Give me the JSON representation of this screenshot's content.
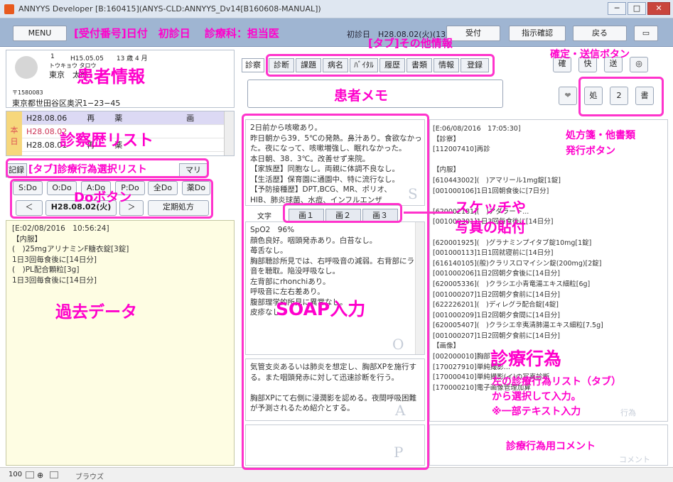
{
  "window": {
    "title": "ANNYYS Developer [B:160415](ANYS-CLD:ANNYYS_Dv14[B160608-MANUAL])",
    "min": "─",
    "max": "□",
    "close": "✕"
  },
  "toolbar": {
    "menu": "MENU",
    "header_text": "初診日　H28.08.02(火)(13歳)",
    "reception": "受付",
    "instruction_confirm": "指示確認",
    "back": "戻る"
  },
  "patient": {
    "id_number": "1",
    "birth": "H15.05.05　　13 歳 4 月",
    "kana": "トウキョウ タロウ",
    "name": "東京　太郎",
    "postal": "〒1580083",
    "address": "東京都世田谷区奥沢1−23−45"
  },
  "history": {
    "today_label": "本\n日",
    "rows": [
      {
        "date": "H28.08.06",
        "kind": "再",
        "cat": "薬",
        "extra": "画"
      },
      {
        "date": "H28.08.02",
        "kind": "",
        "cat": "",
        "extra": ""
      },
      {
        "date": "H28.08.01",
        "kind": "再",
        "cat": "薬",
        "extra": ""
      }
    ]
  },
  "left_tabs": {
    "record": "記録",
    "summary": "マリ"
  },
  "do_buttons": [
    "S:Do",
    "O:Do",
    "A:Do",
    "P:Do",
    "全Do",
    "薬Do"
  ],
  "date_nav": {
    "prev": "＜",
    "date": "H28.08.02(火)",
    "next": "＞",
    "fixed_rx": "定期処方"
  },
  "past_data": {
    "text": "[E:02/08/2016　10:56:24]\n【内服】\n(　)25mgアリナミンF糖衣錠[3錠]\n1日3回毎食後に[14日分]\n(　)PL配合顆粒[3g]\n1日3回毎食後に[14日分]"
  },
  "center_tabs": {
    "shin": "診察",
    "tabs": [
      "診断",
      "課題",
      "病名",
      "ﾊﾞｲﾀﾙ",
      "履歴",
      "書類",
      "情報",
      "登録"
    ]
  },
  "right_buttons": {
    "fav": "❤",
    "rx": "処",
    "two": "2",
    "doc": "書"
  },
  "soap": {
    "s_text": "2日前から咳嗽あり。\n昨日朝から39．5℃の発熱。鼻汁あり。食欲なかった。夜になって、咳嗽増強し、眠れなかった。\n本日朝、38．3℃。改善せず来院。\n【家族歴】同胞なし。両親に体調不良なし。\n【生活歴】保育園に通園中、特に流行なし。\n【予防接種歴】DPT,BCG、MR、ポリオ、\nHIB、肺炎球菌、水痘、インフルエンザ",
    "s_letter": "S",
    "mode_label": "文字",
    "image_tabs": [
      "画１",
      "画２",
      "画３"
    ],
    "o_text": "SpO2　96%\n顔色良好。咽頭発赤あり。白苔なし。\n苺舌なし。\n胸部聴診所見では、右呼吸音の減弱。右背部にラ音を聴取。陥没呼吸なし。\n左背部にrhonchiあり。\n呼吸音に左右差あり。\n腹部理学的所見に異常なし。\n皮疹なし。",
    "o_letter": "O",
    "a_text": "気管支炎あるいは肺炎を想定し、胸部XPを施行する。また咽頭発赤に対して迅速診断を行う。\n\n胸部XPにて右側に浸潤影を認める。夜間呼吸困難が予測されるため紹介とする。",
    "a_letter": "A",
    "p_letter": "P"
  },
  "orders": {
    "text": "[E:06/08/2016　17:05:30]\n【診察】\n[112007410]再診\n\n【内服】\n[610443002](　)アマリール1mg錠[1錠]\n[001000106]1日1回朝食後に[7日分]\n\n[620002181](　)アダラート...\n[001000301]1日3回毎食後に[14日分]\n\n[620001925](　)グラナミンプイタブ錠10mg[1錠]\n[001000113]1日1回就寝前に[14日分]\n[616140105](般)クラリスロマイシン錠(200mg)[2錠]\n[001000206]1日2回朝夕食後に[14日分]\n[620005336](　)クラシエ小青竜湯エキス細粒[6g]\n[001000207]1日2回朝夕食前に[14日分]\n[622226201](　)ディレグラ配合錠[4錠]\n[001000209]1日2回朝夕食間に[14日分]\n[620005407](　)クラシエ辛夷清肺湯エキス細粒[7.5g]\n[001000207]1日2回朝夕食前に[14日分]\n【画像】\n[002000010]胸部\n[170027910]単純撮影...\n[170000410]単純撮影(イ)の写真診断\n[170000210]電子画像管理加算",
    "comment_placeholder": "コメント",
    "faded_hint": "行為"
  },
  "annotations": {
    "header": "[受付番号]日付　初診日　 診療科：担当医",
    "other_info": "[タブ]その他情報",
    "confirm_send": "確定・送信ボタン",
    "patient_info": "患者情報",
    "patient_memo": "患者メモ",
    "history_list": "診察歴リスト",
    "rx_docs": "処方箋・他書類\n発行ボタン",
    "tab_action_list": "[タブ]診療行為選択リスト",
    "do_button": "Doボタン",
    "sketch_photo": "スケッチや\n写真の貼付",
    "past_data": "過去データ",
    "soap_input": "SOAP入力",
    "medical_action": "診療行為",
    "medical_action_desc": "左の診療行為リスト（タブ）\nから選択して入力。\n※一部テキスト入力",
    "action_comment": "診療行為用コメント"
  },
  "statusbar": {
    "zoom": "100",
    "browse": "ブラウズ"
  }
}
